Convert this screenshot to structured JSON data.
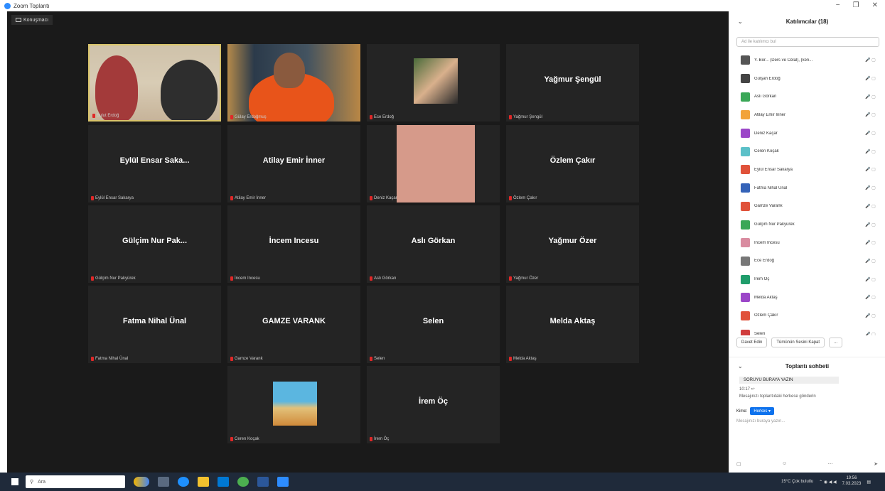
{
  "window": {
    "title": "Zoom Toplantı",
    "controls": [
      "−",
      "❐",
      "✕"
    ]
  },
  "stage": {
    "view_button": "Konuşmacı"
  },
  "tiles": [
    {
      "name": "",
      "label": "Bulut Erdoğ",
      "type": "photo1",
      "active": true
    },
    {
      "name": "",
      "label": "Gülay Erdoğmuş",
      "type": "photo2"
    },
    {
      "name": "",
      "label": "Ece Erdoğ",
      "type": "thumb-face"
    },
    {
      "name": "Yağmur Şengül",
      "label": "Yağmur Şengül"
    },
    {
      "name": "Eylül Ensar Saka...",
      "label": "Eylül Ensar Sakarya"
    },
    {
      "name": "Atilay Emir İnner",
      "label": "Atilay Emir İnner"
    },
    {
      "name": "",
      "label": "Deniz Kaçar",
      "type": "pink"
    },
    {
      "name": "Özlem Çakır",
      "label": "Özlem Çakır"
    },
    {
      "name": "Gülçim Nur Pak...",
      "label": "Gülçim Nur Pakyürek"
    },
    {
      "name": "İncem Incesu",
      "label": "İncem Incesu"
    },
    {
      "name": "Aslı Görkan",
      "label": "Aslı Görkan"
    },
    {
      "name": "Yağmur Özer",
      "label": "Yağmur Özer"
    },
    {
      "name": "Fatma Nihal Ünal",
      "label": "Fatma Nihal Ünal"
    },
    {
      "name": "GAMZE VARANK",
      "label": "Gamze Varank"
    },
    {
      "name": "Selen",
      "label": "Selen"
    },
    {
      "name": "Melda Aktaş",
      "label": "Melda Aktaş"
    },
    {
      "name": "",
      "label": "Ceren Koçak",
      "type": "beach"
    },
    {
      "name": "İrem Öç",
      "label": "İrem Öç"
    }
  ],
  "participants_panel": {
    "title": "Katılımcılar (18)",
    "search_placeholder": "Ad ile katılımcı bul",
    "participants": [
      {
        "name": "Y. Bor... (Ders ve Celal), (ken...",
        "color": "#555555",
        "icons": "🎤 ▢"
      },
      {
        "name": "Gülşah Erdoğ",
        "color": "#444444",
        "icons": "🎤 ▢"
      },
      {
        "name": "Aslı Görkan",
        "color": "#3aa757",
        "icons": "🎤 ▢"
      },
      {
        "name": "Atilay Emir İnner",
        "color": "#f2a33a",
        "icons": "🎤 ▢"
      },
      {
        "name": "Deniz Kaçar",
        "color": "#9b46c8",
        "icons": "🎤 ▢"
      },
      {
        "name": "Ceren Koçak",
        "color": "#5bc0c8",
        "icons": "🎤 ▢"
      },
      {
        "name": "Eylül Ensar Sakarya",
        "color": "#e0523a",
        "icons": "🎤 ▢"
      },
      {
        "name": "Fatma Nihal Ünal",
        "color": "#3563b8",
        "icons": "🎤 ▢"
      },
      {
        "name": "Gamze Varank",
        "color": "#e0523a",
        "icons": "🎤 ▢"
      },
      {
        "name": "Gülçim Nur Pakyürek",
        "color": "#3aa757",
        "icons": "🎤 ▢"
      },
      {
        "name": "İncem Incesu",
        "color": "#d98ca0",
        "icons": "🎤 ▢"
      },
      {
        "name": "Ece Erdoğ",
        "color": "#777777",
        "icons": "🎤 ▢"
      },
      {
        "name": "İrem Öç",
        "color": "#1f9d6b",
        "icons": "🎤 ▢"
      },
      {
        "name": "Melda Aktaş",
        "color": "#9b46c8",
        "icons": "🎤 ▢"
      },
      {
        "name": "Özlem Çakır",
        "color": "#e0523a",
        "icons": "🎤 ▢"
      },
      {
        "name": "Selen",
        "color": "#d03c3c",
        "icons": "🎤 ▢"
      }
    ],
    "buttons": [
      "Davet Edin",
      "Tümünün Sesini Kapat",
      "..."
    ]
  },
  "chat_panel": {
    "title": "Toplantı sohbeti",
    "lines": [
      "SORUYU BURAYA YAZIN",
      "10:17 ↩",
      "Mesajınızı toplantıdaki herkese gönderin"
    ],
    "to_label": "Kime:",
    "to_value": "Herkes ▾",
    "input_placeholder": "Mesajınızı buraya yazın...",
    "tools": [
      "▢",
      "☺",
      "⋯",
      "➤"
    ]
  },
  "taskbar": {
    "search_text": "Ara",
    "tray_text": "15°C Çok bulutlu",
    "time": "19:56",
    "date": "7.03.2023"
  }
}
